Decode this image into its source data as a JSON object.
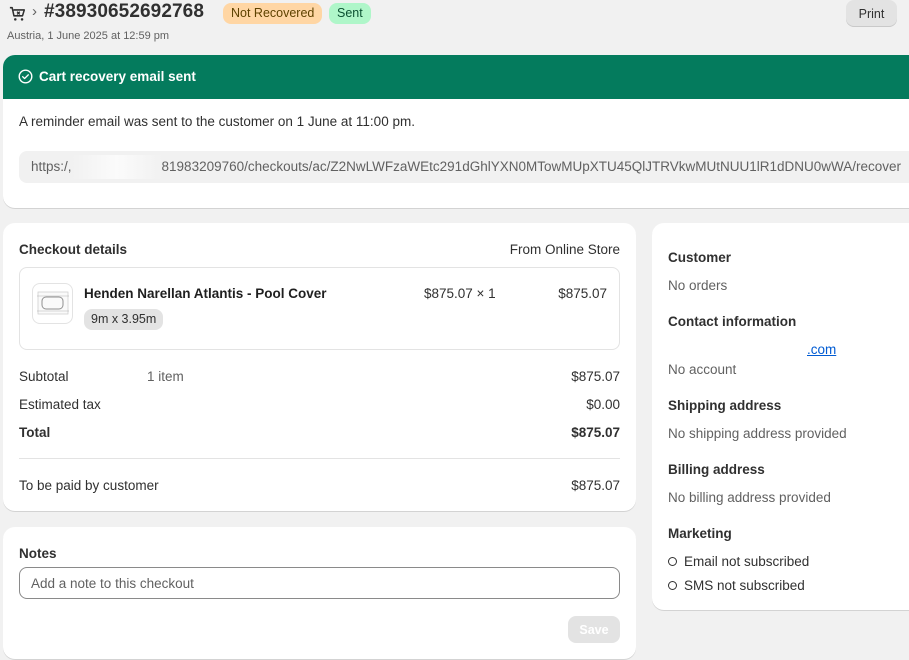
{
  "header": {
    "order_id": "#38930652692768",
    "badges": [
      "Not Recovered",
      "Sent"
    ],
    "subtitle": "Austria, 1 June 2025 at 12:59 pm",
    "print_label": "Print"
  },
  "banner": {
    "title": "Cart recovery email sent",
    "message": "A reminder email was sent to the customer on 1 June at 11:00 pm.",
    "url_prefix": "https:/,",
    "url_rest": "81983209760/checkouts/ac/Z2NwLWFzaWEtc291dGhlYXN0MTowMUpXTU45QlJTRVkwMUtNUU1lR1dDNU0wWA/recover"
  },
  "checkout": {
    "title": "Checkout details",
    "source": "From Online Store",
    "item": {
      "name": "Henden Narellan Atlantis - Pool Cover",
      "variant": "9m x 3.95m",
      "unit_price_qty": "$875.07 × 1",
      "line_total": "$875.07"
    },
    "subtotal_label": "Subtotal",
    "subtotal_count": "1 item",
    "subtotal_value": "$875.07",
    "tax_label": "Estimated tax",
    "tax_value": "$0.00",
    "total_label": "Total",
    "total_value": "$875.07",
    "to_pay_label": "To be paid by customer",
    "to_pay_value": "$875.07"
  },
  "notes": {
    "title": "Notes",
    "placeholder": "Add a note to this checkout",
    "save_label": "Save"
  },
  "customer": {
    "title": "Customer",
    "orders": "No orders",
    "contact_title": "Contact information",
    "email_fragment": ".com",
    "account": "No account",
    "shipping_title": "Shipping address",
    "shipping_value": "No shipping address provided",
    "billing_title": "Billing address",
    "billing_value": "No billing address provided",
    "marketing_title": "Marketing",
    "email_status": "Email not subscribed",
    "sms_status": "SMS not subscribed"
  },
  "colors": {
    "banner_green": "#047b5d",
    "badge_orange": "#ffd6a4",
    "badge_green": "#aff6c9",
    "link_blue": "#005bd3"
  }
}
